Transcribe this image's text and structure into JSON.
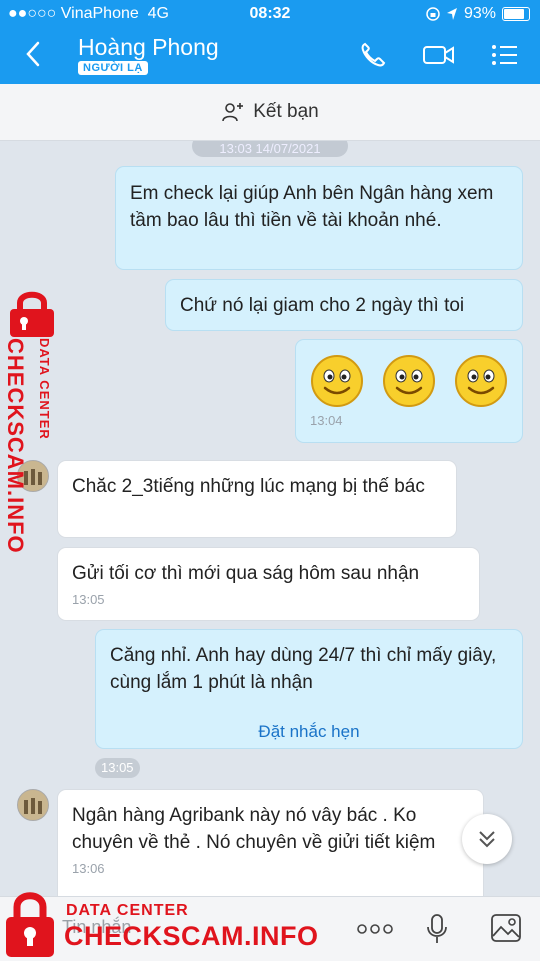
{
  "status": {
    "carrier": "●●○○○ VinaPhone",
    "network": "4G",
    "time": "08:32",
    "battery": "93%"
  },
  "header": {
    "contact_name": "Hoàng Phong",
    "badge": "NGƯỜI LẠ",
    "add_friend": "Kết bạn"
  },
  "chat": {
    "date_separator": "13:03 14/07/2021",
    "messages": [
      {
        "dir": "out",
        "text": "Em check lại giúp Anh bên Ngân hàng xem tầm bao lâu thì tiền về tài khoản nhé."
      },
      {
        "dir": "out",
        "text": "Chứ nó lại giam cho 2 ngày thì toi"
      },
      {
        "dir": "out",
        "type": "sticker",
        "time": "13:04"
      },
      {
        "dir": "in",
        "text": "Chăc 2_3tiếng những lúc mạng bị thế bác"
      },
      {
        "dir": "in",
        "text": "Gửi tối cơ thì mới qua ság hôm sau nhận",
        "time": "13:05"
      },
      {
        "dir": "out",
        "text": "Căng nhỉ. Anh hay dùng 24/7 thì chỉ mấy giây, cùng lắm 1 phút là nhận",
        "action": "Đặt nhắc hẹn"
      },
      {
        "type": "time",
        "time": "13:05"
      },
      {
        "dir": "in",
        "text": "Ngân hàng Agribank này nó vây bác . Ko chuyên về thẻ . Nó chuyên về giửi tiết kiệm",
        "time": "13:06"
      }
    ]
  },
  "input": {
    "placeholder": "Tin nhắn"
  },
  "watermark": {
    "line1": "DATA CENTER",
    "line2": "CHECKSCAM.INFO"
  },
  "icons": [
    "back-icon",
    "phone-icon",
    "video-call-icon",
    "menu-icon",
    "add-friend-icon",
    "scroll-down-icon",
    "more-icon",
    "mic-icon",
    "image-icon"
  ],
  "colors": {
    "header": "#1a9bf0",
    "outgoing_bubble": "#d5f1fd",
    "incoming_bubble": "#ffffff",
    "watermark": "#e0141d",
    "link": "#1a73c8"
  }
}
